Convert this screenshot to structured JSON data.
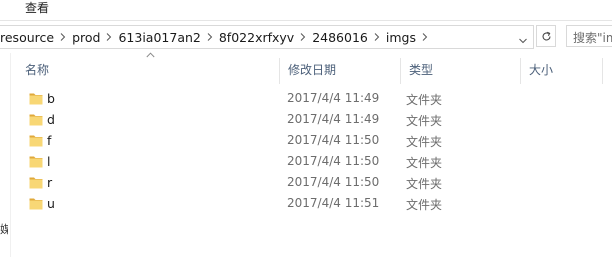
{
  "ribbon": {
    "view_tab": "查看"
  },
  "address": {
    "crumbs": [
      "resource",
      "prod",
      "613ia017an2",
      "8f022xrfxyv",
      "2486016",
      "imgs"
    ]
  },
  "search": {
    "placeholder": "搜索\"im"
  },
  "nav_fragment": "媒",
  "columns": {
    "name": "名称",
    "date": "修改日期",
    "type": "类型",
    "size": "大小"
  },
  "files": [
    {
      "name": "b",
      "date": "2017/4/4 11:49",
      "type": "文件夹"
    },
    {
      "name": "d",
      "date": "2017/4/4 11:49",
      "type": "文件夹"
    },
    {
      "name": "f",
      "date": "2017/4/4 11:50",
      "type": "文件夹"
    },
    {
      "name": "l",
      "date": "2017/4/4 11:50",
      "type": "文件夹"
    },
    {
      "name": "r",
      "date": "2017/4/4 11:50",
      "type": "文件夹"
    },
    {
      "name": "u",
      "date": "2017/4/4 11:51",
      "type": "文件夹"
    }
  ],
  "colors": {
    "folder_body": "#f8d775",
    "folder_tab": "#e0a93b",
    "header_text": "#4c607a"
  },
  "icons": {
    "sort": "sort-up-icon",
    "separator": "chevron-right-icon",
    "refresh": "refresh-icon",
    "dropdown": "chevron-down-icon",
    "folder": "folder-icon"
  }
}
